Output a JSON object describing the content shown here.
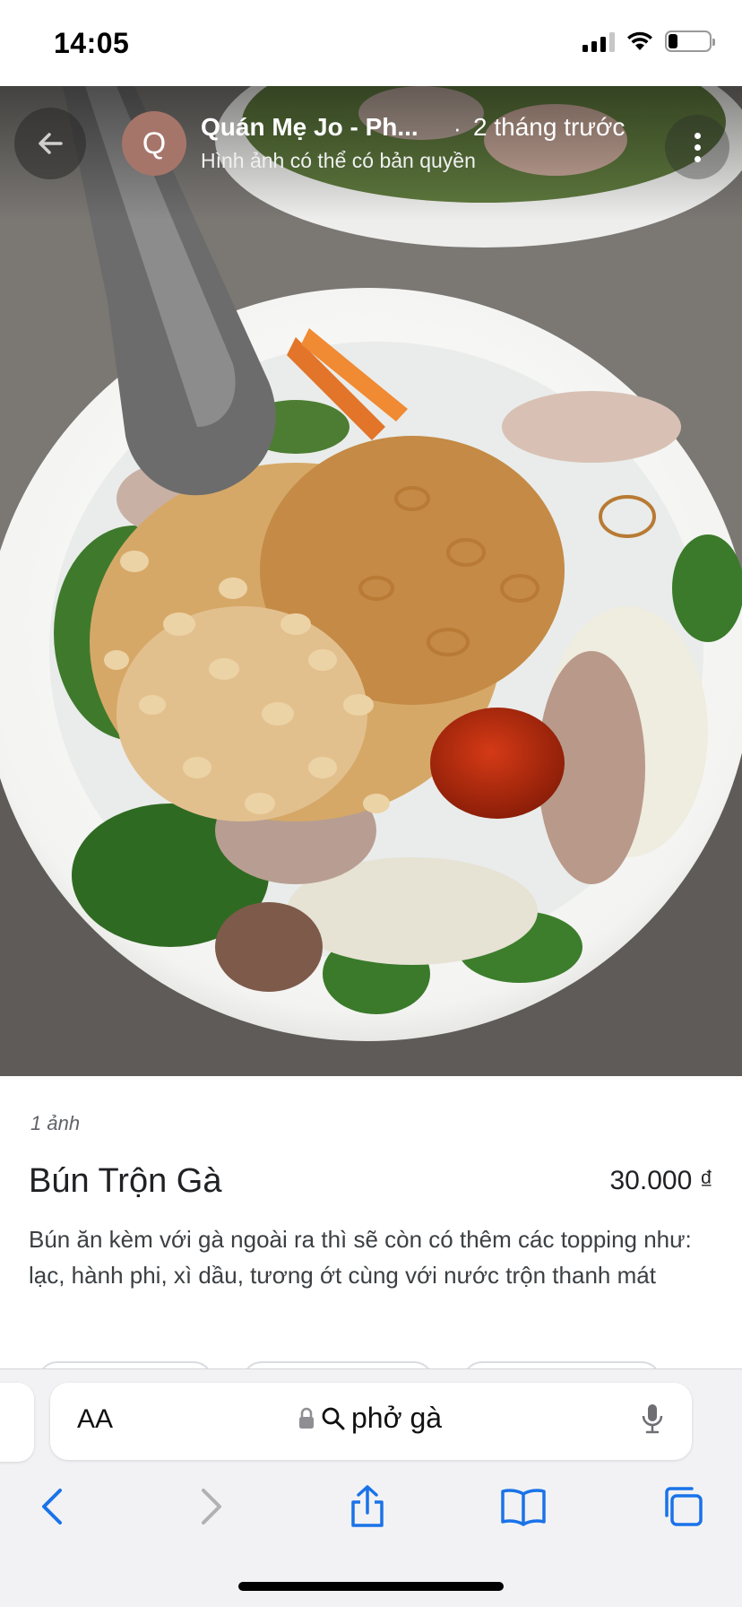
{
  "status_bar": {
    "time": "14:05",
    "battery_level": 0.2,
    "signal_bars": 3,
    "icons": [
      "cellular-signal-icon",
      "wifi-icon",
      "battery-icon"
    ]
  },
  "photo_header": {
    "avatar_letter": "Q",
    "place_name": "Quán Mẹ Jo - Ph...",
    "separator": "·",
    "time_ago": "2 tháng trước",
    "copyright_note": "Hình ảnh có thể có bản quyền",
    "icons": [
      "back-arrow-icon",
      "more-vert-icon"
    ]
  },
  "content": {
    "photo_count": "1 ảnh",
    "dish_name": "Bún Trộn Gà",
    "price": "30.000 ₫",
    "description": "Bún ăn kèm với gà ngoài ra thì sẽ còn có thêm các topping như: lạc, hành phi, xì dầu, tương ớt cùng với nước trộn thanh mát"
  },
  "browser": {
    "text_size_label": "AA",
    "url_query": "phở gà",
    "icons": [
      "lock-icon",
      "search-icon",
      "microphone-icon",
      "back-icon",
      "forward-icon",
      "share-icon",
      "bookmarks-icon",
      "tabs-icon"
    ],
    "accent_color": "#1a73e8",
    "disabled_color": "#b0b0b5"
  }
}
